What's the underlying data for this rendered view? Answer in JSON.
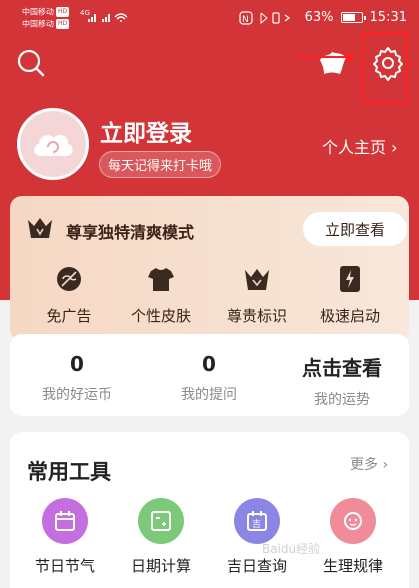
{
  "status_bar": {
    "carrier1": "中国移动",
    "carrier2": "中国移动",
    "hd": "HD",
    "net1": "4G",
    "net2": "5G",
    "battery": "63%",
    "time": "15:31"
  },
  "profile": {
    "login_title": "立即登录",
    "login_subtitle": "每天记得来打卡哦",
    "homepage_link": "个人主页 ›"
  },
  "vip": {
    "title": "尊享独特清爽模式",
    "button": "立即查看",
    "perks": [
      {
        "label": "免广告",
        "icon": "no-ads-icon"
      },
      {
        "label": "个性皮肤",
        "icon": "tshirt-icon"
      },
      {
        "label": "尊贵标识",
        "icon": "crown-icon"
      },
      {
        "label": "极速启动",
        "icon": "bolt-phone-icon"
      }
    ]
  },
  "stats": [
    {
      "value": "0",
      "label": "我的好运币"
    },
    {
      "value": "0",
      "label": "我的提问"
    },
    {
      "value": "点击查看",
      "label": "我的运势"
    }
  ],
  "tools": {
    "title": "常用工具",
    "more": "更多 ›",
    "items": [
      {
        "label": "节日节气",
        "icon": "calendar-icon",
        "color": "#c56ee0"
      },
      {
        "label": "日期计算",
        "icon": "date-calc-icon",
        "color": "#7cc97a"
      },
      {
        "label": "吉日查询",
        "icon": "lucky-day-icon",
        "color": "#8a86e6"
      },
      {
        "label": "生理规律",
        "icon": "face-icon",
        "color": "#f08b9a"
      }
    ]
  },
  "watermark": "Baidu经验",
  "colors": {
    "brand_red": "#d23438",
    "vip_gold": "#f5d8c3",
    "annotation_red": "#ff2020"
  }
}
